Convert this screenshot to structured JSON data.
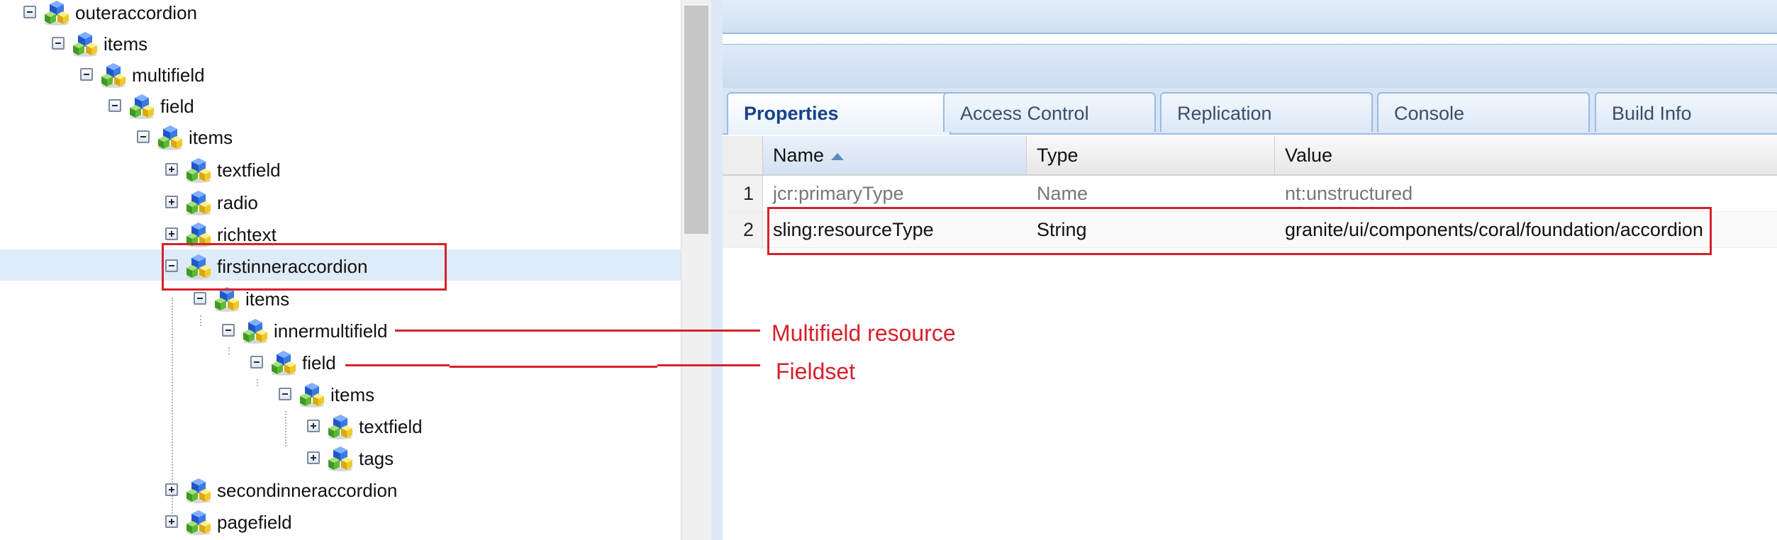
{
  "tree": {
    "nodes": [
      {
        "label": "outeraccordion",
        "toggle": "minus",
        "expanded": true
      },
      {
        "label": "items",
        "toggle": "minus",
        "expanded": true
      },
      {
        "label": "multifield",
        "toggle": "minus",
        "expanded": true
      },
      {
        "label": "field",
        "toggle": "minus",
        "expanded": true
      },
      {
        "label": "items",
        "toggle": "minus",
        "expanded": true
      },
      {
        "label": "textfield",
        "toggle": "plus",
        "expanded": false
      },
      {
        "label": "radio",
        "toggle": "plus",
        "expanded": false
      },
      {
        "label": "richtext",
        "toggle": "plus",
        "expanded": false
      },
      {
        "label": "firstinneraccordion",
        "toggle": "minus",
        "expanded": true,
        "selected": true
      },
      {
        "label": "items",
        "toggle": "minus",
        "expanded": true
      },
      {
        "label": "innermultifield",
        "toggle": "minus",
        "expanded": true
      },
      {
        "label": "field",
        "toggle": "minus",
        "expanded": true
      },
      {
        "label": "items",
        "toggle": "minus",
        "expanded": true
      },
      {
        "label": "textfield",
        "toggle": "plus",
        "expanded": false
      },
      {
        "label": "tags",
        "toggle": "plus",
        "expanded": false
      },
      {
        "label": "secondinneraccordion",
        "toggle": "plus",
        "expanded": false
      },
      {
        "label": "pagefield",
        "toggle": "plus",
        "expanded": false
      }
    ]
  },
  "tabs": [
    {
      "label": "Properties",
      "active": true
    },
    {
      "label": "Access Control",
      "active": false
    },
    {
      "label": "Replication",
      "active": false
    },
    {
      "label": "Console",
      "active": false
    },
    {
      "label": "Build Info",
      "active": false
    }
  ],
  "grid": {
    "columns": [
      "Name",
      "Type",
      "Value"
    ],
    "sort_column": "Name",
    "sort_direction": "ascending",
    "rows": [
      {
        "num": "1",
        "name": "jcr:primaryType",
        "type": "Name",
        "value": "nt:unstructured"
      },
      {
        "num": "2",
        "name": "sling:resourceType",
        "type": "String",
        "value": "granite/ui/components/coral/foundation/accordion"
      }
    ]
  },
  "annotations": {
    "multifield_label": "Multifield resource",
    "fieldset_label": "Fieldset",
    "color": "#d6212c"
  },
  "colors": {
    "selection": "#deebf8",
    "panel_border": "#99bbe8",
    "active_tab_text": "#15428b"
  },
  "icons": {
    "node": "node-cube-icon",
    "expand": "expand-plus-icon",
    "collapse": "collapse-minus-icon",
    "sort": "sort-ascending-icon"
  }
}
